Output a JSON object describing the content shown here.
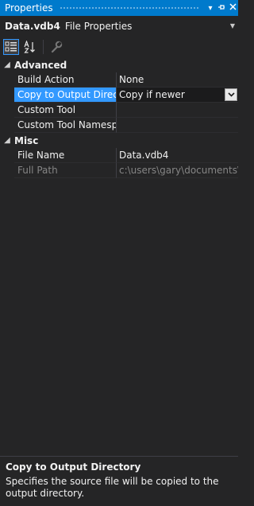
{
  "window": {
    "title": "Properties"
  },
  "object": {
    "name": "Data.vdb4",
    "type": "File Properties"
  },
  "categories": [
    {
      "name": "Advanced",
      "rows": [
        {
          "name": "Build Action",
          "value": "None"
        },
        {
          "name": "Copy to Output Directo",
          "value": "Copy if newer"
        },
        {
          "name": "Custom Tool",
          "value": ""
        },
        {
          "name": "Custom Tool Namespac",
          "value": ""
        }
      ]
    },
    {
      "name": "Misc",
      "rows": [
        {
          "name": "File Name",
          "value": "Data.vdb4"
        },
        {
          "name": "Full Path",
          "value": "c:\\users\\gary\\documents\\vi"
        }
      ]
    }
  ],
  "description": {
    "title": "Copy to Output Directory",
    "text": "Specifies the source file will be copied to the output directory."
  },
  "colors": {
    "accent": "#007acc",
    "selection": "#3399ff",
    "background": "#252526"
  }
}
